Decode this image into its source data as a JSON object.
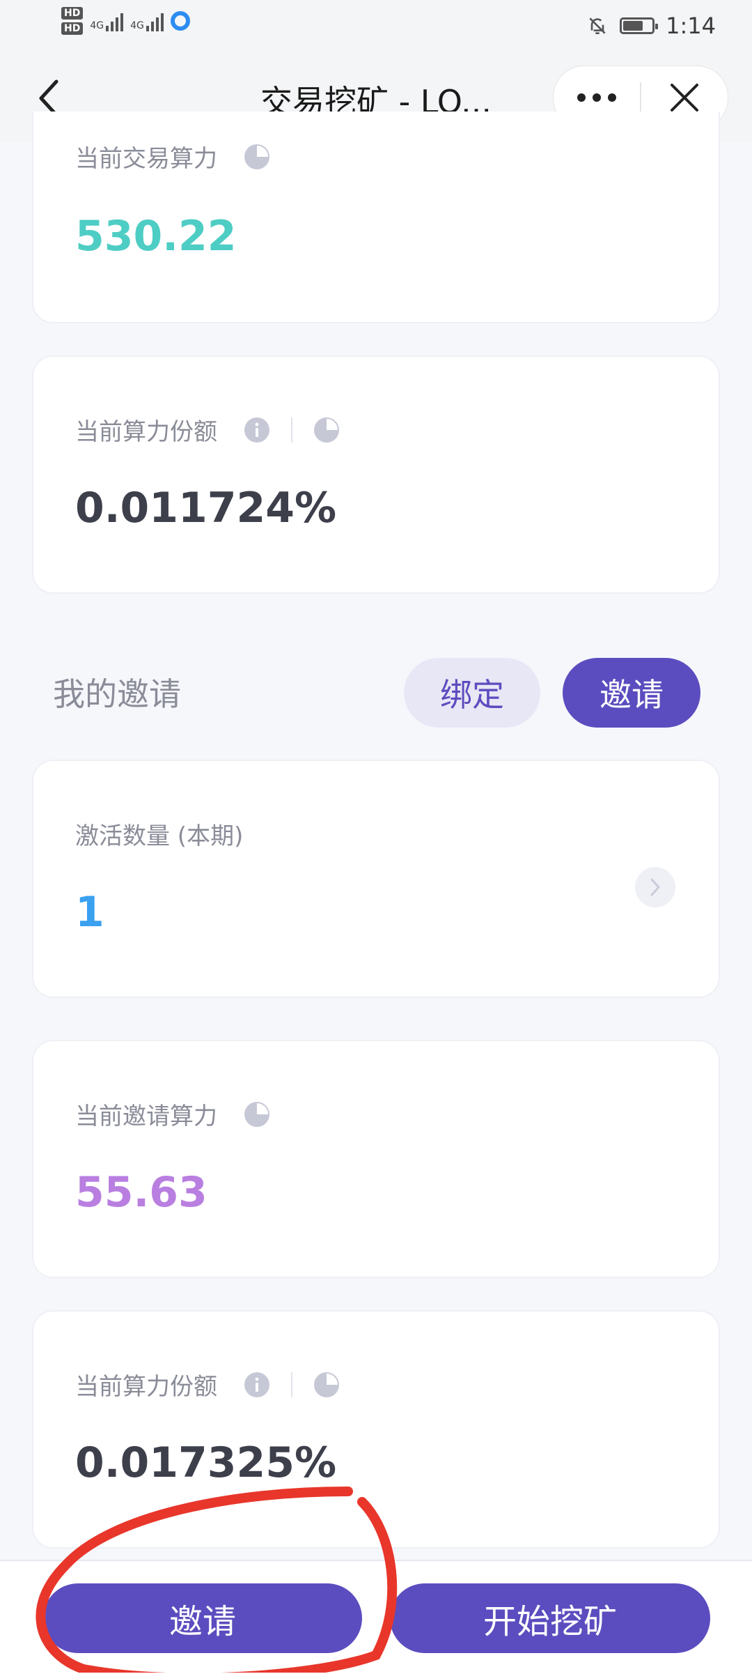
{
  "status_bar": {
    "time": "1:14",
    "hd1": "HD",
    "hd2": "HD",
    "net1": "4G",
    "net2": "4G"
  },
  "nav": {
    "title": "交易挖矿 - LO..."
  },
  "mining": {
    "trade_power_label": "当前交易算力",
    "trade_power_value": "530.22",
    "share_label": "当前算力份额",
    "share_value": "0.011724%"
  },
  "invite": {
    "section_title": "我的邀请",
    "bind_label": "绑定",
    "invite_label": "邀请",
    "activated_label": "激活数量 (本期)",
    "activated_value": "1",
    "invite_power_label": "当前邀请算力",
    "invite_power_value": "55.63",
    "share_label": "当前算力份额",
    "share_value": "0.017325%"
  },
  "bottom": {
    "invite_label": "邀请",
    "start_label": "开始挖矿"
  },
  "colors": {
    "accent": "#5b4dbf",
    "teal": "#4ecdc4",
    "blue": "#3aa0f0",
    "purple": "#b97fe0",
    "annotation": "#e8362b"
  }
}
